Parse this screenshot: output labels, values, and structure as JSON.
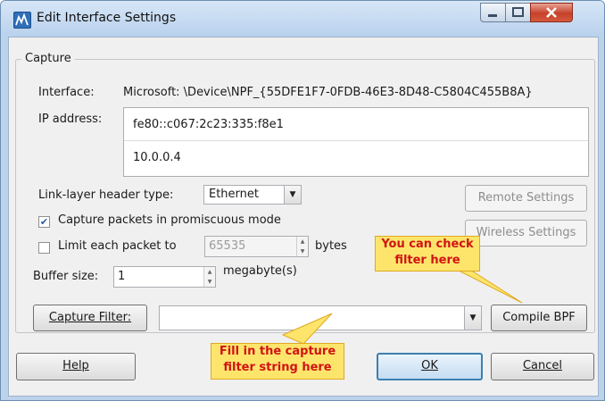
{
  "window": {
    "title": "Edit Interface Settings"
  },
  "capture": {
    "group_title": "Capture",
    "interface_label": "Interface:",
    "interface_value": "Microsoft: \\Device\\NPF_{55DFE1F7-0FDB-46E3-8D48-C5804C455B8A}",
    "ip_label": "IP address:",
    "ip_addresses": [
      "fe80::c067:2c23:335:f8e1",
      "10.0.0.4"
    ],
    "link_layer_label": "Link-layer header type:",
    "link_layer_value": "Ethernet",
    "remote_settings": "Remote Settings",
    "wireless_settings": "Wireless Settings",
    "promiscuous_label": "Capture packets in promiscuous mode",
    "promiscuous_checked": true,
    "limit_label": "Limit each packet to",
    "limit_checked": false,
    "limit_value": "65535",
    "limit_unit": "bytes",
    "buffer_label": "Buffer size:",
    "buffer_value": "1",
    "buffer_unit": "megabyte(s)",
    "capture_filter_button": "Capture Filter:",
    "capture_filter_value": "",
    "compile_bpf": "Compile BPF"
  },
  "footer": {
    "help": "Help",
    "ok": "OK",
    "cancel": "Cancel"
  },
  "annotations": {
    "check_filter": [
      "You can check",
      "filter here"
    ],
    "fill_filter": [
      "Fill in the capture",
      "filter string here"
    ]
  },
  "colors": {
    "callout_bg": "#fde56b",
    "callout_text": "#d01414",
    "titlebar": "#c6dcf2"
  }
}
